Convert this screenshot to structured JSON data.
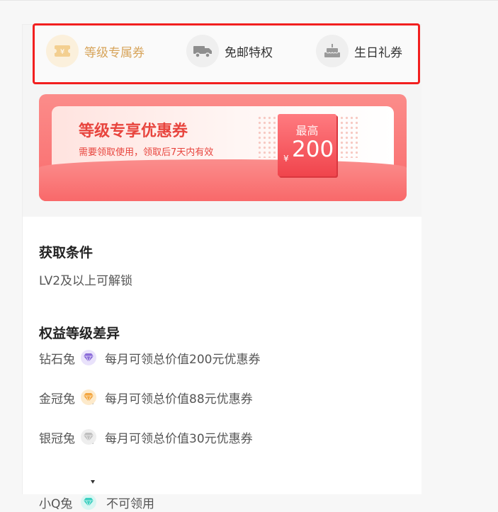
{
  "tabs": [
    {
      "label": "等级专属券",
      "icon": "coupon-ticket-icon",
      "active": true
    },
    {
      "label": "免邮特权",
      "icon": "delivery-truck-icon",
      "active": false
    },
    {
      "label": "生日礼券",
      "icon": "birthday-cake-icon",
      "active": false
    }
  ],
  "banner": {
    "title": "等级专享优惠券",
    "subtitle": "需要领取使用，领取后7天内有效",
    "ticket_top": "最高",
    "currency": "¥",
    "amount": "200"
  },
  "conditions": {
    "heading": "获取条件",
    "text": "LV2及以上可解锁"
  },
  "diff": {
    "heading": "权益等级差异",
    "tiers": [
      {
        "name": "钻石兔",
        "badge": "diamond-rabbit-badge-icon",
        "color": "#8b6cd9",
        "desc": "每月可领总价值200元优惠券"
      },
      {
        "name": "金冠兔",
        "badge": "gold-crown-badge-icon",
        "color": "#f3a640",
        "desc": "每月可领总价值88元优惠券"
      },
      {
        "name": "银冠兔",
        "badge": "silver-crown-badge-icon",
        "color": "#c0c0c0",
        "desc": "每月可领总价值30元优惠券"
      },
      {
        "name": "小Q兔",
        "badge": "q-rabbit-badge-icon",
        "color": "#3ccfc0",
        "desc": "不可领用"
      }
    ]
  },
  "colors": {
    "highlight_border": "#f21f1f",
    "active_tab_text": "#d7a45a",
    "banner_red": "#fa6b6c",
    "title_red": "#e8453e"
  }
}
